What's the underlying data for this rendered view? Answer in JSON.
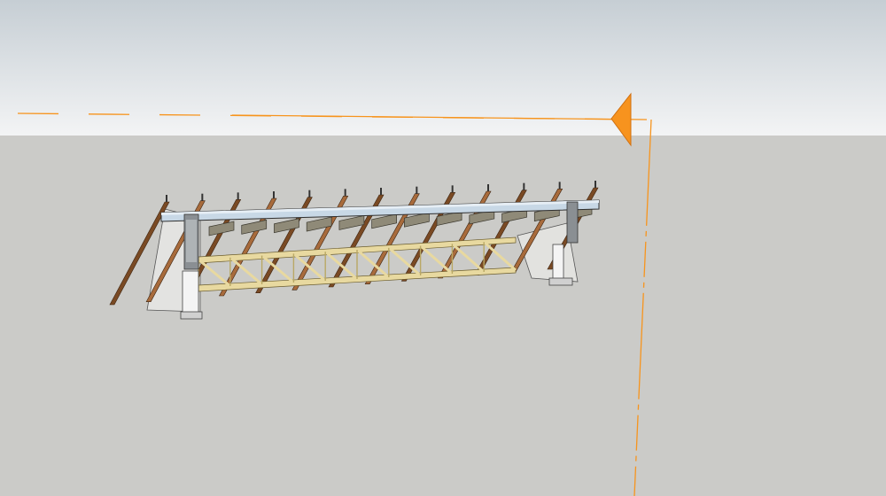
{
  "app": {
    "viewport_label": ""
  },
  "colors": {
    "sky_top": "#c4ccd2",
    "sky_bottom": "#f4f5f6",
    "ground": "#cbcbc8",
    "horizon_line": "#e8e9ea",
    "guide_orange": "#f7941d",
    "cursor_orange": "#f7931e",
    "rafter_wood": "#a86b3c",
    "rafter_wood_dark": "#7a4a24",
    "purlin": "#8f8a78",
    "purlin_top": "#b5b09c",
    "truss_yellow": "#e8d9a0",
    "beam_steel": "#c8d8e6",
    "beam_steel_edge": "#3a3a3a",
    "wall_white": "#f2f2f2",
    "wall_shade": "#dcdcdc",
    "bracket_gray": "#7d8286"
  },
  "scene": {
    "model_name": "roof-framing-model",
    "cursor_tool": "move-tool-cursor",
    "guide_axes": [
      "horizontal-guide",
      "vertical-guide"
    ]
  }
}
